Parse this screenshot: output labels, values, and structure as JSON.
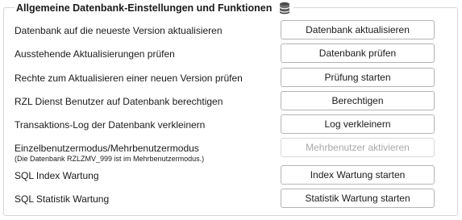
{
  "group": {
    "title": "Allgemeine Datenbank-Einstellungen und Funktionen",
    "icon": "database-icon"
  },
  "rows": [
    {
      "label": "Datenbank auf die neueste Version aktualisieren",
      "button": "Datenbank aktualisieren",
      "enabled": true
    },
    {
      "label": "Ausstehende Aktualisierungen prüfen",
      "button": "Datenbank prüfen",
      "enabled": true
    },
    {
      "label": "Rechte zum Aktualisieren einer neuen Version prüfen",
      "button": "Prüfung starten",
      "enabled": true
    },
    {
      "label": "RZL Dienst Benutzer auf Datenbank berechtigen",
      "button": "Berechtigen",
      "enabled": true
    },
    {
      "label": "Transaktions-Log der Datenbank verkleinern",
      "button": "Log verkleinern",
      "enabled": true
    },
    {
      "label": "Einzelbenutzermodus/Mehrbenutzermodus",
      "sublabel": "(Die Datenbank RZLZMV_999 ist im Mehrbenutzermodus.)",
      "button": "Mehrbenutzer aktivieren",
      "enabled": false
    },
    {
      "label": "SQL Index Wartung",
      "button": "Index Wartung starten",
      "enabled": true
    },
    {
      "label": "SQL Statistik Wartung",
      "button": "Statistik Wartung starten",
      "enabled": true
    }
  ]
}
